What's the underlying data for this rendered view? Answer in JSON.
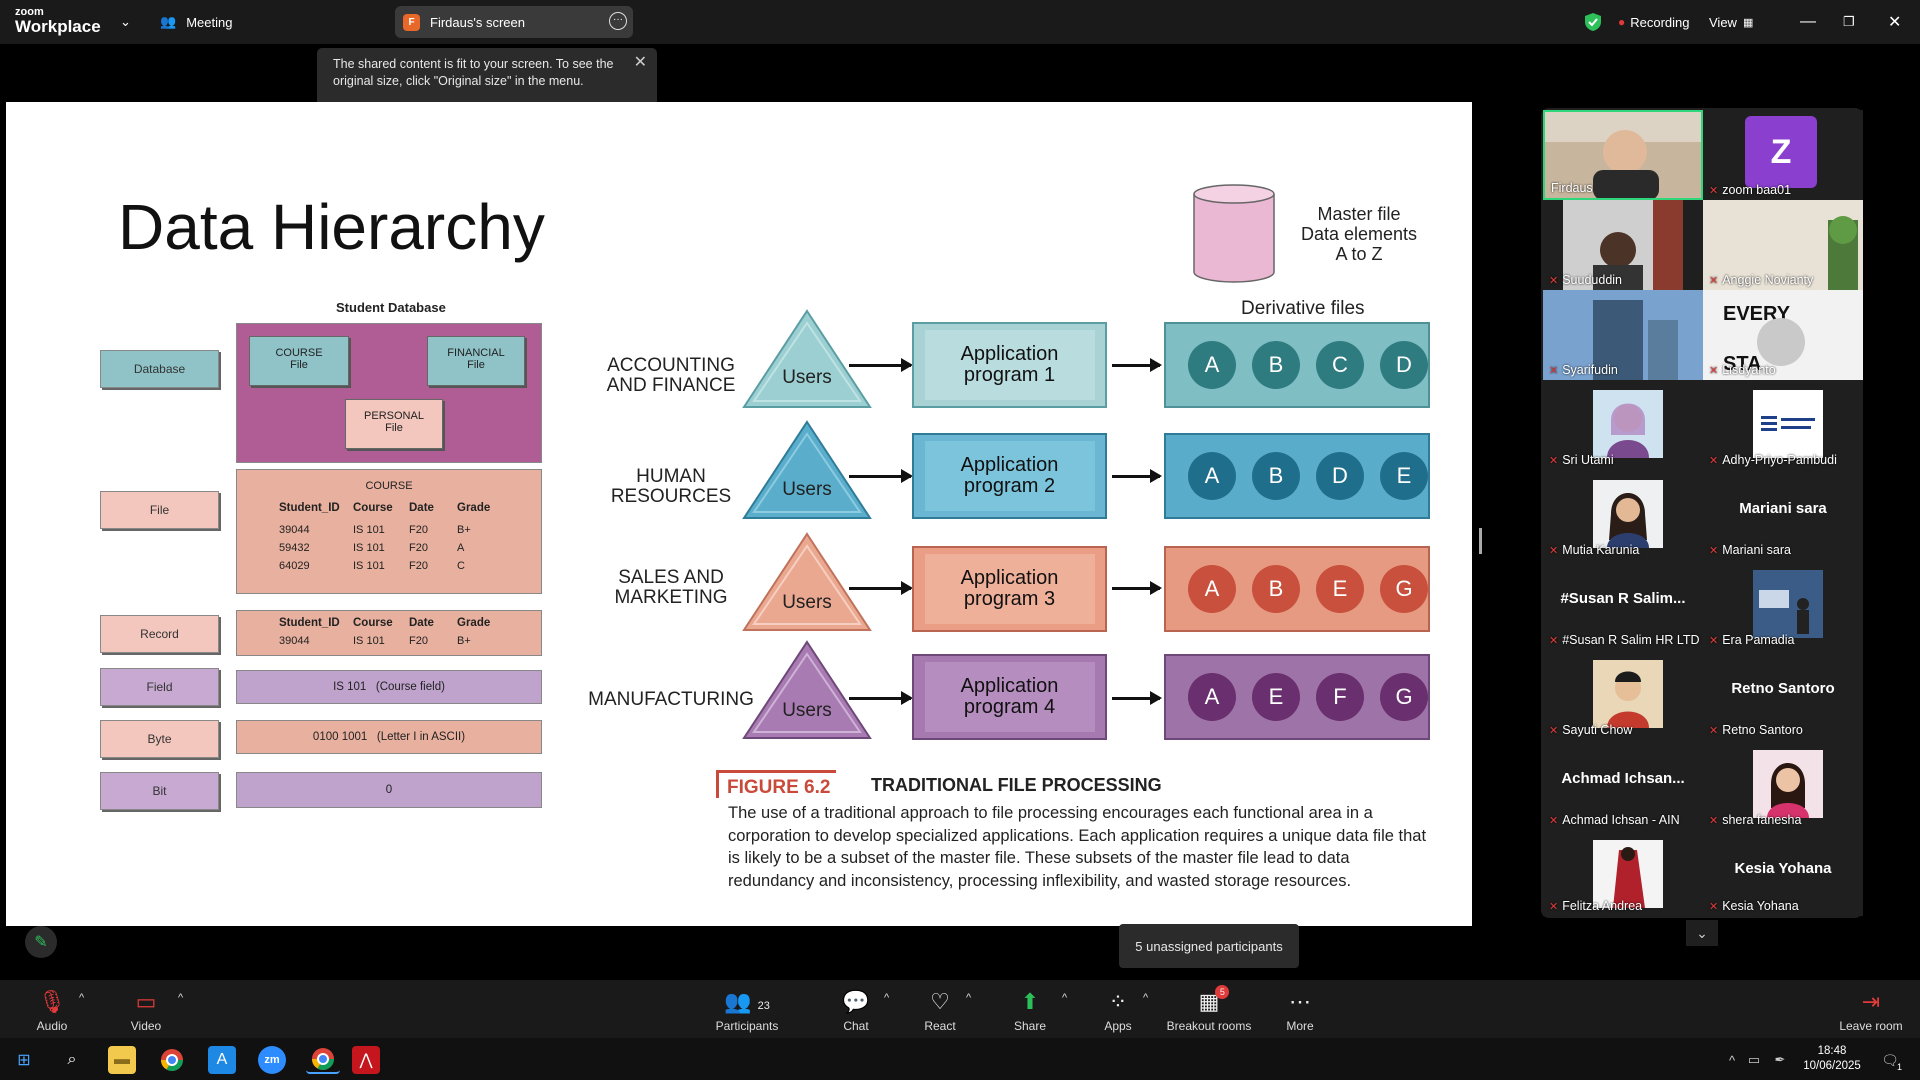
{
  "topbar": {
    "logo_small": "zoom",
    "logo_big": "Workplace",
    "meeting_label": "Meeting",
    "share_tab": "Firdaus's screen",
    "share_tab_initial": "F",
    "recording_label": "Recording",
    "view_label": "View"
  },
  "tooltip": {
    "text": "The shared content is fit to your screen. To see the original size, click \"Original size\" in the menu."
  },
  "slide": {
    "title": "Data Hierarchy",
    "hierarchy": {
      "db_title": "Student Database",
      "levels": [
        "Database",
        "File",
        "Record",
        "Field",
        "Byte",
        "Bit"
      ],
      "files": [
        "COURSE\nFile",
        "FINANCIAL\nFile",
        "PERSONAL\nFile"
      ],
      "file_title": "COURSE",
      "columns": [
        "Student_ID",
        "Course",
        "Date",
        "Grade"
      ],
      "rows": [
        [
          "39044",
          "IS 101",
          "F20",
          "B+"
        ],
        [
          "59432",
          "IS 101",
          "F20",
          "A"
        ],
        [
          "64029",
          "IS 101",
          "F20",
          "C"
        ]
      ],
      "record_columns": [
        "Student_ID",
        "Course",
        "Date",
        "Grade"
      ],
      "record_row": [
        "39044",
        "IS 101",
        "F20",
        "B+"
      ],
      "field_value": "IS 101   (Course field)",
      "byte_value": "0100 1001   (Letter I in ASCII)",
      "bit_value": "0"
    },
    "processing": {
      "master_file": "Master file\nData elements\nA to Z",
      "derivative_title": "Derivative files",
      "users_label": "Users",
      "departments": [
        {
          "name": "ACCOUNTING\nAND FINANCE",
          "app": "Application\nprogram 1",
          "files": [
            "A",
            "B",
            "C",
            "D"
          ]
        },
        {
          "name": "HUMAN\nRESOURCES",
          "app": "Application\nprogram 2",
          "files": [
            "A",
            "B",
            "D",
            "E"
          ]
        },
        {
          "name": "SALES AND\nMARKETING",
          "app": "Application\nprogram 3",
          "files": [
            "A",
            "B",
            "E",
            "G"
          ]
        },
        {
          "name": "MANUFACTURING",
          "app": "Application\nprogram 4",
          "files": [
            "A",
            "E",
            "F",
            "G"
          ]
        }
      ],
      "figure_label": "FIGURE 6.2",
      "figure_title": "TRADITIONAL FILE PROCESSING",
      "caption": "The use of a traditional approach to file processing encourages each functional area in a corporation to develop specialized applications. Each application requires a unique data file that is likely to be a subset of the master file. These subsets of the master file lead to data redundancy and inconsistency, processing inflexibility, and wasted storage resources."
    }
  },
  "participants": [
    {
      "name": "Firdaus",
      "muted": false,
      "type": "video"
    },
    {
      "name": "zoom baa01",
      "muted": true,
      "type": "letter",
      "letter": "Z"
    },
    {
      "name": "Suududdin",
      "muted": true,
      "type": "video"
    },
    {
      "name": "Anggie Novianty",
      "muted": true,
      "type": "video"
    },
    {
      "name": "Syarifudin",
      "muted": true,
      "type": "video"
    },
    {
      "name": "Lisdyanto",
      "muted": true,
      "type": "video"
    },
    {
      "name": "Sri Utami",
      "muted": true,
      "type": "photo"
    },
    {
      "name": "Adhy-Priyo-Pambudi",
      "muted": true,
      "type": "photo"
    },
    {
      "name": "Mutia Karunia",
      "muted": true,
      "type": "photo"
    },
    {
      "name": "Mariani sara",
      "muted": true,
      "type": "text",
      "big": "Mariani sara"
    },
    {
      "name": "#Susan R Salim HR LTD",
      "muted": true,
      "type": "text",
      "big": "#Susan R Salim..."
    },
    {
      "name": "Era Pamadia",
      "muted": true,
      "type": "photo"
    },
    {
      "name": "Sayuti Chow",
      "muted": true,
      "type": "photo"
    },
    {
      "name": "Retno Santoro",
      "muted": true,
      "type": "text",
      "big": "Retno Santoro"
    },
    {
      "name": "Achmad Ichsan - AIN",
      "muted": true,
      "type": "text",
      "big": "Achmad  Ichsan..."
    },
    {
      "name": "shera fanesha",
      "muted": true,
      "type": "photo"
    },
    {
      "name": "Felitza Andrea",
      "muted": true,
      "type": "photo"
    },
    {
      "name": "Kesia Yohana",
      "muted": true,
      "type": "text",
      "big": "Kesia Yohana"
    }
  ],
  "unassigned": "5 unassigned participants",
  "bottombar": {
    "audio": "Audio",
    "video": "Video",
    "participants": "Participants",
    "participants_count": "23",
    "chat": "Chat",
    "react": "React",
    "share": "Share",
    "apps": "Apps",
    "breakout": "Breakout rooms",
    "breakout_badge": "5",
    "more": "More",
    "leave": "Leave room"
  },
  "taskbar": {
    "time": "18:48",
    "date": "10/06/2025",
    "notif": "1"
  },
  "colors": {
    "accent_green": "#2dbf5a",
    "recording_red": "#e03a3a",
    "speaker_border": "#2ed87a"
  }
}
